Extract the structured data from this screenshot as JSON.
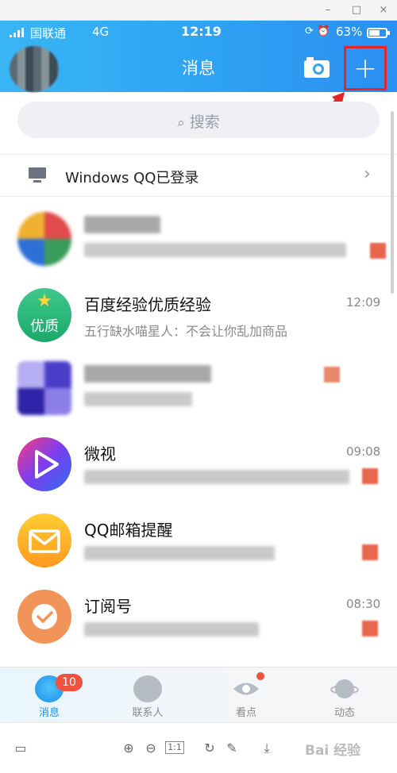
{
  "window": {
    "minimize": "–",
    "maximize": "□",
    "close": "×"
  },
  "status_bar": {
    "carrier": "国联通",
    "network": "4G",
    "time": "12:19",
    "battery_percent": "63%",
    "battery_level": 0.63,
    "icons": [
      "sync-icon",
      "alarm-icon"
    ]
  },
  "nav": {
    "title": "消息",
    "camera_icon": "camera-icon",
    "add_label": "+"
  },
  "search": {
    "placeholder": "搜索"
  },
  "pc_login": {
    "label": "Windows QQ已登录"
  },
  "messages": [
    {
      "name": "",
      "time": "",
      "preview": ""
    },
    {
      "name": "百度经验优质经验",
      "time": "12:09",
      "preview": "五行缺水喵星人：不会让你乱加商品",
      "avatar_top": "★",
      "avatar_text": "优质"
    },
    {
      "name": "",
      "time": "",
      "preview": ""
    },
    {
      "name": "微视",
      "time": "09:08",
      "preview": ""
    },
    {
      "name": "QQ邮箱提醒",
      "time": "",
      "preview": ""
    },
    {
      "name": "订阅号",
      "time": "08:30",
      "preview": ""
    }
  ],
  "tabs": [
    {
      "label": "消息",
      "badge": "10",
      "icon": "message-icon"
    },
    {
      "label": "联系人",
      "icon": "contacts-icon"
    },
    {
      "label": "看点",
      "icon": "eye-icon"
    },
    {
      "label": "动态",
      "icon": "planet-icon"
    }
  ],
  "viewer": {
    "watermark": "Bai 经验",
    "page_label": "1:1"
  },
  "colors": {
    "header_start": "#3ab6f5",
    "header_end": "#2c8ff2",
    "highlight_red": "#e4262a",
    "badge_red": "#f0523d",
    "active_tab": "#1b8de8"
  }
}
